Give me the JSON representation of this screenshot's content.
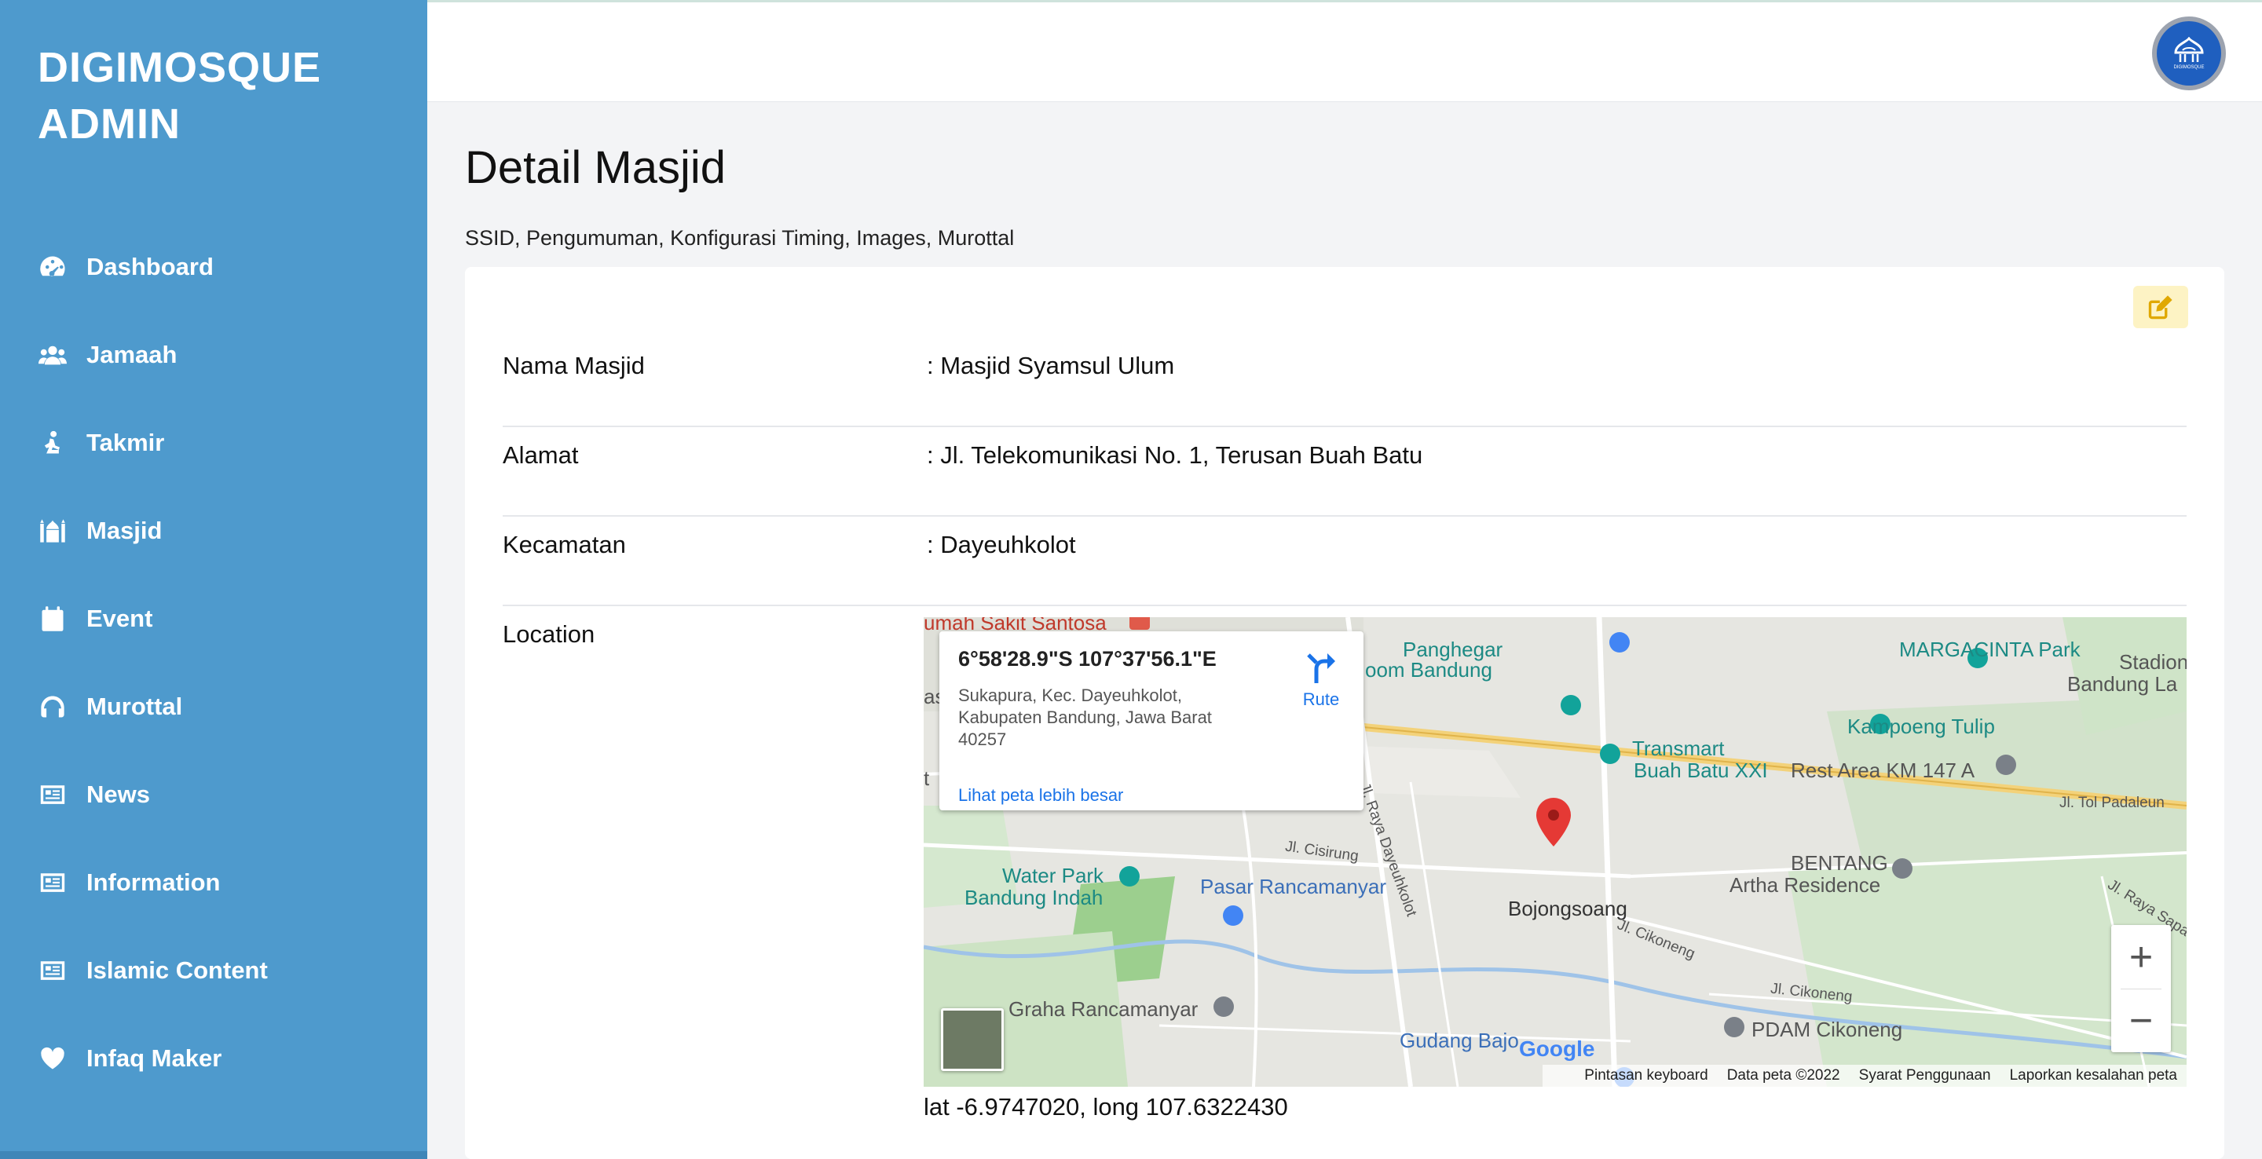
{
  "app": {
    "brand": "DIGIMOSQUE\nADMIN"
  },
  "sidebar": {
    "items": [
      {
        "label": "Dashboard",
        "icon": "dashboard-icon"
      },
      {
        "label": "Jamaah",
        "icon": "users-icon"
      },
      {
        "label": "Takmir",
        "icon": "praying-person-icon"
      },
      {
        "label": "Masjid",
        "icon": "mosque-icon"
      },
      {
        "label": "Event",
        "icon": "calendar-icon"
      },
      {
        "label": "Murottal",
        "icon": "headphones-icon"
      },
      {
        "label": "News",
        "icon": "newspaper-icon"
      },
      {
        "label": "Information",
        "icon": "newspaper-icon"
      },
      {
        "label": "Islamic Content",
        "icon": "newspaper-icon"
      },
      {
        "label": "Infaq Maker",
        "icon": "heart-icon"
      }
    ]
  },
  "header": {
    "avatar_logo_text": "DIGIMOSQUE"
  },
  "page": {
    "title": "Detail Masjid",
    "subtitle": "SSID, Pengumuman, Konfigurasi Timing, Images, Murottal"
  },
  "details": {
    "nama_label": "Nama Masjid",
    "nama_value": ": Masjid Syamsul Ulum",
    "alamat_label": "Alamat",
    "alamat_value": ": Jl. Telekomunikasi No. 1, Terusan Buah Batu",
    "kecamatan_label": "Kecamatan",
    "kecamatan_value": ": Dayeuhkolot",
    "location_label": "Location",
    "latlong": "lat -6.9747020, long 107.6322430"
  },
  "map": {
    "info": {
      "coord": "6°58'28.9\"S 107°37'56.1\"E",
      "address": "Sukapura, Kec. Dayeuhkolot, Kabupaten Bandung, Jawa Barat 40257",
      "link": "Lihat peta lebih besar",
      "rute": "Rute"
    },
    "places": {
      "rs_santosa": "umah Sakit Santosa",
      "panghegar": "Panghegar",
      "oom_bandung": "oom Bandung",
      "margacinta": "MARGACINTA Park",
      "stadion": "Stadion",
      "bandung_la": "Bandung La",
      "kampoeng": "Kampoeng Tulip",
      "transmart": "Transmart",
      "buah_batu": "Buah Batu XXI",
      "rest_area": "Rest Area KM 147 A",
      "tol": "Jl. Tol Padaleun",
      "water_park": "Water Park",
      "bandung_indah": "Bandung Indah",
      "pasar": "Pasar Rancamanyar",
      "bojongsoang": "Bojongsoang",
      "bentang": "BENTANG",
      "artha": "Artha Residence",
      "graha": "Graha Rancamanyar",
      "gudang": "Gudang Bajo",
      "pdam": "PDAM Cikoneng",
      "cisirung": "Jl. Cisirung",
      "dayeuhkolot_rd": "Jl. Raya Dayeuhkolot",
      "cikoneng1": "Jl. Cikoneng",
      "cikoneng2": "Jl. Cikoneng",
      "raya_sapan": "Jl. Raya Sapa",
      "as": "as",
      "t": "t"
    },
    "attribution": {
      "keyboard": "Pintasan keyboard",
      "data": "Data peta ©2022",
      "terms": "Syarat Penggunaan",
      "report": "Laporkan kesalahan peta",
      "google": "Google"
    },
    "zoom_in": "+",
    "zoom_out": "−"
  },
  "colors": {
    "sidebar": "#4e9acd",
    "edit_button_bg": "#fdf3c4",
    "edit_icon": "#e0a800",
    "map_pin": "#e53935",
    "link": "#1a73e8"
  }
}
